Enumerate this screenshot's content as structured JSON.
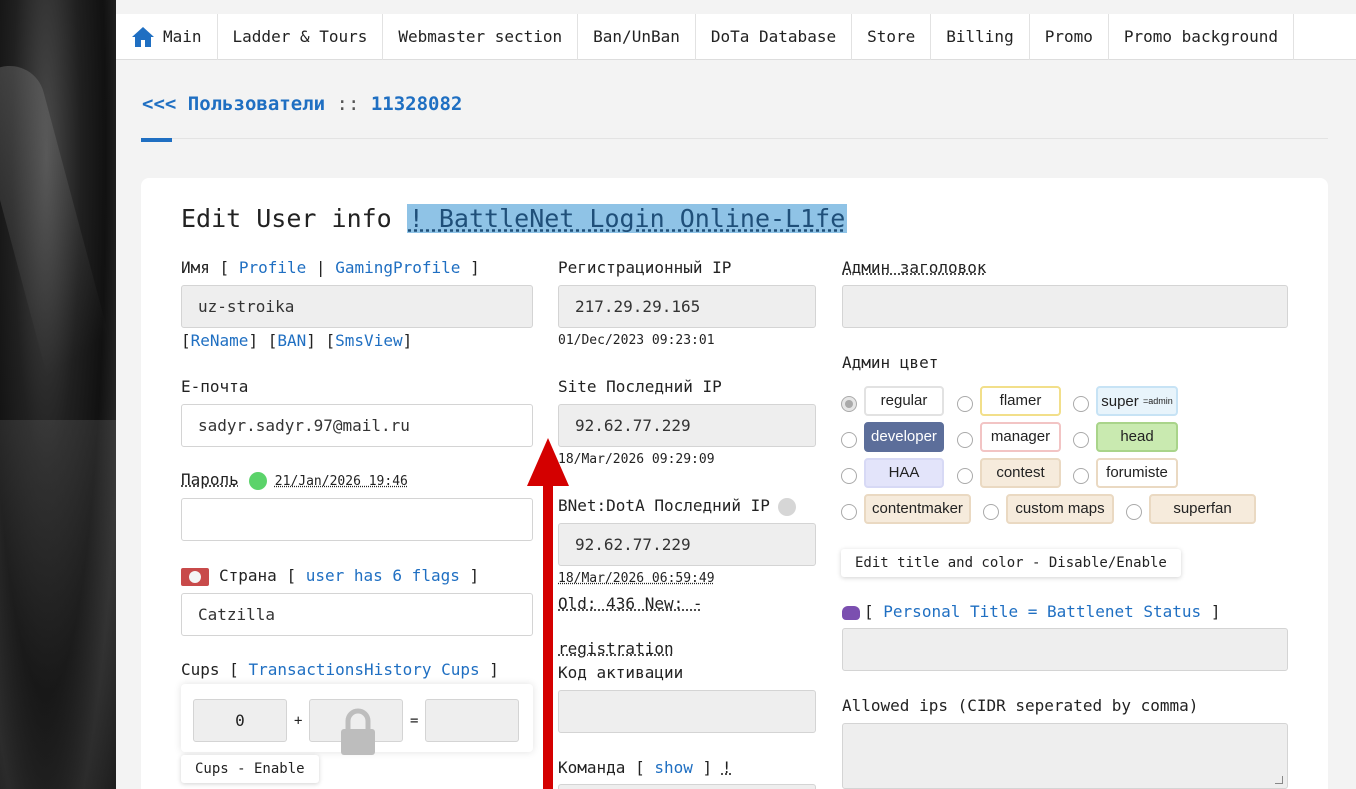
{
  "nav": {
    "items": [
      "Main",
      "Ladder & Tours",
      "Webmaster section",
      "Ban/UnBan",
      "DoTa Database",
      "Store",
      "Billing",
      "Promo",
      "Promo background"
    ]
  },
  "breadcrumb": {
    "back": "<<<",
    "section": "Пользователи",
    "separator": "::",
    "id": "11328082"
  },
  "form": {
    "title": "Edit User info",
    "title_highlight": "! BattleNet Login Online-L1fe",
    "name": {
      "label": "Имя",
      "open": "[",
      "profile": "Profile",
      "pipe": "|",
      "gaming_profile": "GamingProfile",
      "close": "]",
      "value": "uz-stroika",
      "actions": [
        "ReName",
        "BAN",
        "SmsView"
      ]
    },
    "email": {
      "label": "E-почта",
      "value": "sadyr.sadyr.97@mail.ru"
    },
    "password": {
      "label": "Пароль",
      "date": "21/Jan/2026 19:46",
      "value": ""
    },
    "country": {
      "label": "Страна",
      "open": "[",
      "link": "user has 6 flags",
      "close": "]",
      "value": "Catzilla"
    },
    "cups": {
      "label": "Cups",
      "open": "[",
      "link": "TransactionsHistory Cups",
      "close": "]",
      "value": "0",
      "plus": "+",
      "equals": "=",
      "toggle": "Cups - Enable"
    },
    "reg_ip": {
      "label": "Регистрационный IP",
      "value": "217.29.29.165",
      "date": "01/Dec/2023 09:23:01"
    },
    "site_ip": {
      "label": "Site Последний IP",
      "value": "92.62.77.229",
      "date": "18/Mar/2026 09:29:09"
    },
    "bnet_ip": {
      "label": "BNet:DotA Последний IP",
      "value": "92.62.77.229",
      "date": "18/Mar/2026 06:59:49"
    },
    "old_new": "Old: 436 New: -",
    "registration": "registration",
    "activation": {
      "label": "Код активации",
      "value": ""
    },
    "team": {
      "label": "Команда",
      "open": "[",
      "link": "show",
      "close": "]",
      "mark": "!"
    },
    "admin_title": {
      "label": "Админ заголовок",
      "value": ""
    },
    "admin_color": {
      "label": "Админ цвет",
      "roles": [
        "regular",
        "flamer",
        "super",
        "developer",
        "manager",
        "head",
        "HAA",
        "contest",
        "forumiste",
        "contentmaker",
        "custom maps",
        "superfan"
      ],
      "super_suffix": "=admin",
      "toggle": "Edit title and color - Disable/Enable"
    },
    "personal_title": {
      "open": "[",
      "link": "Personal Title = Battlenet Status",
      "close": "]",
      "value": ""
    },
    "allowed_ips": {
      "label": "Allowed ips (CIDR seperated by comma)",
      "value": ""
    }
  },
  "colors": {
    "accent": "#1f6fc2",
    "annotation_arrow": "#d40000",
    "online_dot": "#5bd36a"
  }
}
